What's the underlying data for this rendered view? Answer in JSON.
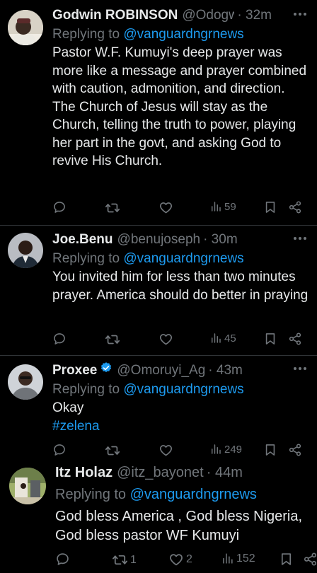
{
  "tweets": [
    {
      "name": "Godwin ROBINSON",
      "handle": "@Odogw...",
      "time": "· 32m",
      "replying_prefix": "Replying to ",
      "replying_to": "@vanguardngrnews",
      "text": "Pastor W.F. Kumuyi's deep prayer was more like a message and prayer combined with caution, admonition, and direction.\nThe Church of Jesus will stay as the Church, telling the truth to power, playing her part in the govt, and asking God to revive His Church.",
      "views": "59"
    },
    {
      "name": "Joe.Benu",
      "handle": "@benujoseph",
      "time": "· 30m",
      "replying_prefix": "Replying to ",
      "replying_to": "@vanguardngrnews",
      "text": "You invited him for less than two minutes prayer. America should do better in praying",
      "views": "45"
    },
    {
      "name": "Proxee",
      "handle": "@Omoruyi_Ag",
      "time": "· 43m",
      "replying_prefix": "Replying to ",
      "replying_to": "@vanguardngrnews",
      "text": "Okay",
      "hashtag": "#zelena",
      "views": "249"
    },
    {
      "name": "Itz Holaz",
      "handle": "@itz_bayonet",
      "time": "· 44m",
      "replying_prefix": "Replying to ",
      "replying_to": "@vanguardngrnews",
      "text": "God bless America , God bless Nigeria, God bless pastor WF Kumuyi",
      "retweets": "1",
      "likes": "2",
      "views": "152"
    }
  ],
  "colors": {
    "background": "#000000",
    "text": "#e7e9ea",
    "muted": "#71767b",
    "link": "#1d9bf0",
    "divider": "#2f3336"
  },
  "icons": [
    "reply-icon",
    "retweet-icon",
    "like-icon",
    "views-icon",
    "bookmark-icon",
    "share-icon",
    "more-icon",
    "verified-badge-icon"
  ]
}
